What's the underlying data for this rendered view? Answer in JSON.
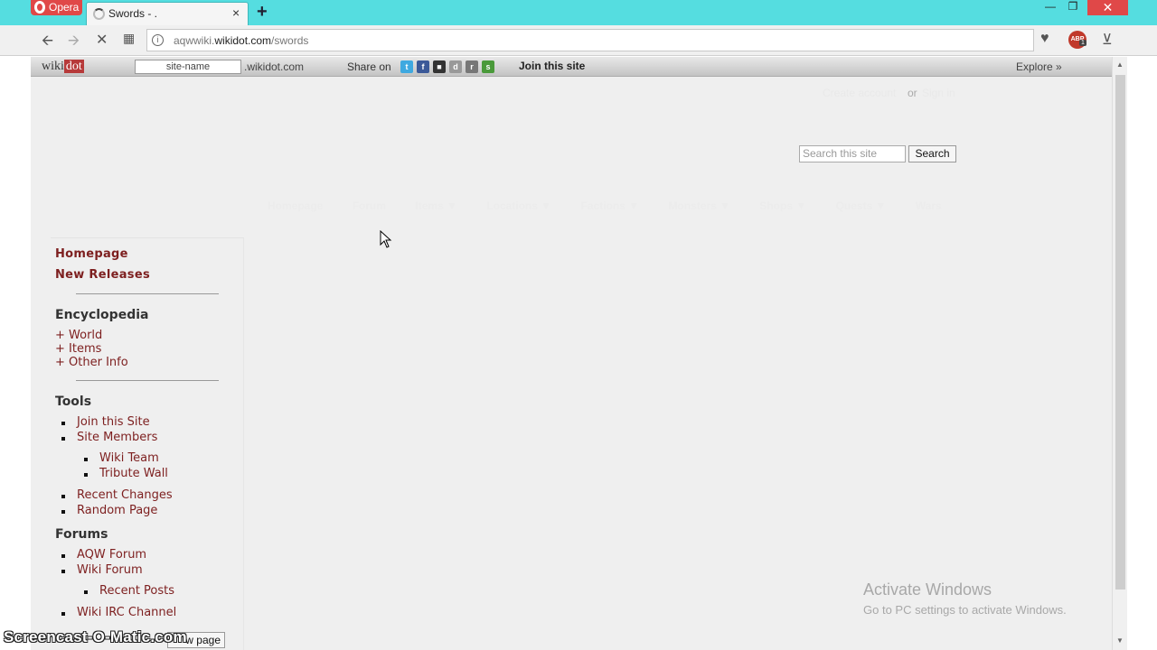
{
  "browser": {
    "menu_label": "Opera",
    "tab_title": "Swords - .",
    "tab_close": "×",
    "new_tab": "+",
    "window": {
      "minimize": "—",
      "maximize": "❐",
      "close": "✕"
    },
    "url_prefix": "aqwwiki.",
    "url_domain": "wikidot.com",
    "url_path": "/swords",
    "icons": [
      "back-icon",
      "forward-icon",
      "stop-icon",
      "speed-dial-icon",
      "site-info-icon",
      "heart-icon",
      "adblock-icon",
      "download-icon"
    ],
    "adblock_label": "ABP",
    "adblock_count": "1"
  },
  "wikidot_bar": {
    "logo_prefix": "wiki",
    "logo_suffix": "dot",
    "site_name_placeholder": "site-name",
    "domain": ".wikidot.com",
    "share_label": "Share on",
    "join_label": "Join this site",
    "explore_label": "Explore »"
  },
  "header": {
    "create_account": "Create account",
    "or": "or",
    "sign_in": "Sign in",
    "search_placeholder": "Search this site",
    "search_button": "Search"
  },
  "topnav": [
    "Homepage",
    "Forum",
    "Items ▼",
    "Locations ▼",
    "Factions ▼",
    "Monsters ▼",
    "Shops ▼",
    "Quests ▼",
    "Wars"
  ],
  "sidebar": {
    "homepage": "Homepage",
    "new_releases": "New Releases",
    "encyclopedia": "Encyclopedia",
    "world": "+ World",
    "items": "+ Items",
    "other_info": "+ Other Info",
    "tools": "Tools",
    "join_site": "Join this Site",
    "site_members": "Site Members",
    "wiki_team": "Wiki Team",
    "tribute_wall": "Tribute Wall",
    "recent_changes": "Recent Changes",
    "random_page": "Random Page",
    "forums": "Forums",
    "aqw_forum": "AQW Forum",
    "wiki_forum": "Wiki Forum",
    "recent_posts": "Recent Posts",
    "irc": "Wiki IRC Channel",
    "new_page_btn": "w page"
  },
  "watermark": {
    "activate_title": "Activate Windows",
    "activate_sub": "Go to PC settings to activate Windows.",
    "screencast": "Screencast-O-Matic.com"
  },
  "colors": {
    "titlebar": "#55dde0",
    "link": "#7d1f1f",
    "close": "#e04848"
  }
}
